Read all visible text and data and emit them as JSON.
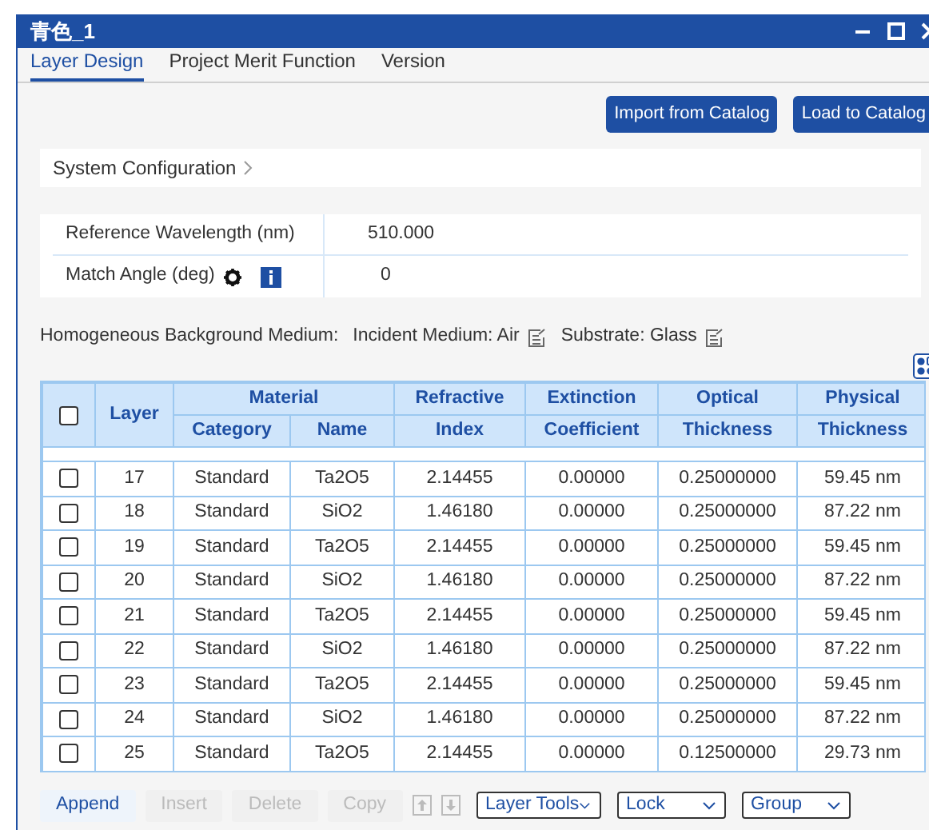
{
  "window": {
    "title": "青色_1"
  },
  "tabs": [
    {
      "label": "Layer Design",
      "selected": true
    },
    {
      "label": "Project Merit Function",
      "selected": false
    },
    {
      "label": "Version",
      "selected": false
    }
  ],
  "actions": [
    "Import from Catalog",
    "Load to Catalog"
  ],
  "system_configuration": {
    "label": "System Configuration",
    "expanded": false
  },
  "parameters": [
    {
      "label": "Reference Wavelength (nm)",
      "value": "510.000",
      "kind": "plain"
    },
    {
      "label": "Match Angle (deg)",
      "value": "0",
      "kind": "icons"
    }
  ],
  "background_medium": {
    "label": "Homogeneous Background Medium:",
    "incident": "Incident Medium: Air",
    "substrate": "Substrate: Glass"
  },
  "table": {
    "select_all": false,
    "columns": {
      "layer": "Layer",
      "material": "Material",
      "category": "Category",
      "name": "Name",
      "refractive": [
        "Refractive",
        "Index"
      ],
      "extinction": [
        "Extinction",
        "Coefficient"
      ],
      "optical": [
        "Optical",
        "Thickness"
      ],
      "physical": [
        "Physical",
        "Thickness"
      ]
    },
    "rows": [
      {
        "checked": false,
        "cells": [
          "17",
          "Standard",
          "Ta2O5",
          "2.14455",
          "0.00000",
          "0.25000000",
          "59.45 nm"
        ]
      },
      {
        "checked": false,
        "cells": [
          "18",
          "Standard",
          "SiO2",
          "1.46180",
          "0.00000",
          "0.25000000",
          "87.22 nm"
        ]
      },
      {
        "checked": false,
        "cells": [
          "19",
          "Standard",
          "Ta2O5",
          "2.14455",
          "0.00000",
          "0.25000000",
          "59.45 nm"
        ]
      },
      {
        "checked": false,
        "cells": [
          "20",
          "Standard",
          "SiO2",
          "1.46180",
          "0.00000",
          "0.25000000",
          "87.22 nm"
        ]
      },
      {
        "checked": false,
        "cells": [
          "21",
          "Standard",
          "Ta2O5",
          "2.14455",
          "0.00000",
          "0.25000000",
          "59.45 nm"
        ]
      },
      {
        "checked": false,
        "cells": [
          "22",
          "Standard",
          "SiO2",
          "1.46180",
          "0.00000",
          "0.25000000",
          "87.22 nm"
        ]
      },
      {
        "checked": false,
        "cells": [
          "23",
          "Standard",
          "Ta2O5",
          "2.14455",
          "0.00000",
          "0.25000000",
          "59.45 nm"
        ]
      },
      {
        "checked": false,
        "cells": [
          "24",
          "Standard",
          "SiO2",
          "1.46180",
          "0.00000",
          "0.25000000",
          "87.22 nm"
        ]
      },
      {
        "checked": false,
        "cells": [
          "25",
          "Standard",
          "Ta2O5",
          "2.14455",
          "0.00000",
          "0.12500000",
          "29.73 nm"
        ]
      }
    ]
  },
  "toolbar": [
    {
      "kind": "text",
      "label": "Append",
      "disabled": false
    },
    {
      "kind": "text",
      "label": "Insert",
      "disabled": true
    },
    {
      "kind": "text",
      "label": "Delete",
      "disabled": true
    },
    {
      "kind": "text",
      "label": "Copy",
      "disabled": true
    },
    {
      "kind": "up",
      "disabled": true
    },
    {
      "kind": "down",
      "disabled": true
    },
    {
      "kind": "dropdown",
      "label": "Layer Tools",
      "disabled": false
    },
    {
      "kind": "dropdown",
      "label": "Lock",
      "disabled": false
    },
    {
      "kind": "dropdown",
      "label": "Group",
      "disabled": false
    }
  ]
}
